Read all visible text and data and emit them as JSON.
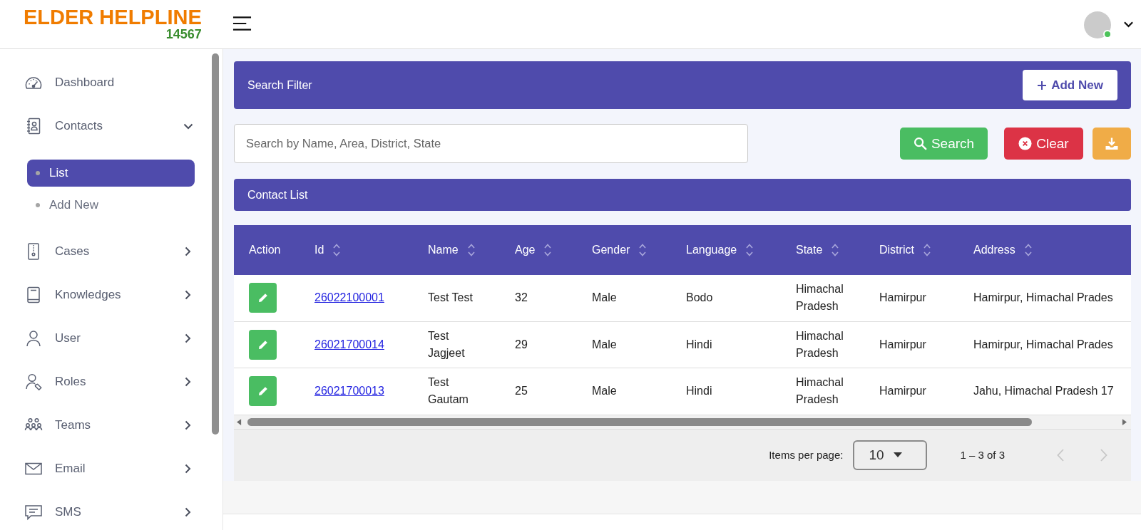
{
  "header": {
    "logo_title": "ELDER HELPLINE",
    "logo_number": "14567",
    "user": {
      "online": true
    }
  },
  "sidebar": {
    "items": [
      {
        "label": "Dashboard",
        "kind": "link"
      },
      {
        "label": "Contacts",
        "kind": "group",
        "expanded": true,
        "children": [
          {
            "label": "List",
            "selected": true
          },
          {
            "label": "Add New",
            "selected": false
          }
        ]
      },
      {
        "label": "Cases",
        "kind": "group",
        "expanded": false
      },
      {
        "label": "Knowledges",
        "kind": "group",
        "expanded": false
      },
      {
        "label": "User",
        "kind": "group",
        "expanded": false
      },
      {
        "label": "Roles",
        "kind": "group",
        "expanded": false
      },
      {
        "label": "Teams",
        "kind": "group",
        "expanded": false
      },
      {
        "label": "Email",
        "kind": "group",
        "expanded": false
      },
      {
        "label": "SMS",
        "kind": "group",
        "expanded": false
      }
    ]
  },
  "search_filter": {
    "title": "Search Filter",
    "add_button": "Add New",
    "search_field": {
      "placeholder": "Search by Name, Area, District, State"
    },
    "buttons": [
      {
        "kind": "search",
        "label": "Search"
      },
      {
        "kind": "clear",
        "label": "Clear"
      },
      {
        "kind": "download"
      }
    ]
  },
  "contact_list": {
    "title": "Contact List",
    "action_header": "Action",
    "columns": [
      {
        "label": "Id",
        "sortable": true
      },
      {
        "label": "Name",
        "sortable": true
      },
      {
        "label": "Age",
        "sortable": true
      },
      {
        "label": "Gender",
        "sortable": true
      },
      {
        "label": "Language",
        "sortable": true
      },
      {
        "label": "State",
        "sortable": true
      },
      {
        "label": "District",
        "sortable": true
      },
      {
        "label": "Address",
        "sortable": true
      }
    ],
    "rows": [
      {
        "cells": [
          "26022100001",
          "Test Test",
          "32",
          "Male",
          "Bodo",
          "Himachal Pradesh",
          "Hamirpur",
          "Hamirpur, Himachal Prades"
        ]
      },
      {
        "cells": [
          "26021700014",
          "Test Jagjeet",
          "29",
          "Male",
          "Hindi",
          "Himachal Pradesh",
          "Hamirpur",
          "Hamirpur, Himachal Prades"
        ]
      },
      {
        "cells": [
          "26021700013",
          "Test Gautam",
          "25",
          "Male",
          "Hindi",
          "Himachal Pradesh",
          "Hamirpur",
          "Jahu, Himachal Pradesh 17"
        ]
      }
    ],
    "pagination": {
      "label": "Items per page:",
      "page_size": "10",
      "range": "1 – 3 of 3",
      "previous_disabled": true,
      "next_disabled": true
    }
  }
}
